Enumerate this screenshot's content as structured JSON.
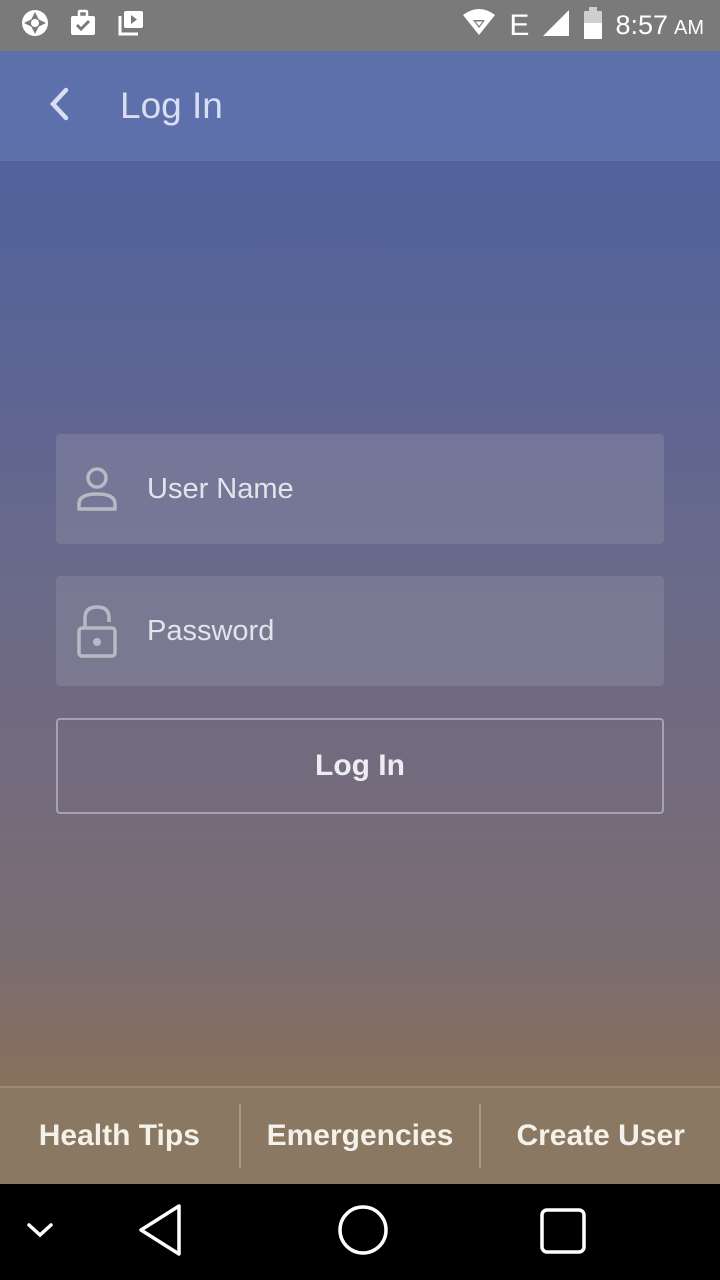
{
  "status_bar": {
    "time": "8:57",
    "ampm": "AM",
    "network_type": "E",
    "icons": [
      "aperture-icon",
      "briefcase-check-icon",
      "media-play-icon",
      "wifi-icon",
      "signal-icon",
      "battery-icon"
    ]
  },
  "app_bar": {
    "title": "Log In"
  },
  "form": {
    "username_placeholder": "User Name",
    "password_placeholder": "Password",
    "login_label": "Log In"
  },
  "bottom_tabs": [
    {
      "label": "Health Tips"
    },
    {
      "label": "Emergencies"
    },
    {
      "label": "Create User"
    }
  ],
  "colors": {
    "status_bar": "#7a7a7a",
    "app_bar": "#6a7cb6",
    "tab_bar": "#8a7862"
  }
}
